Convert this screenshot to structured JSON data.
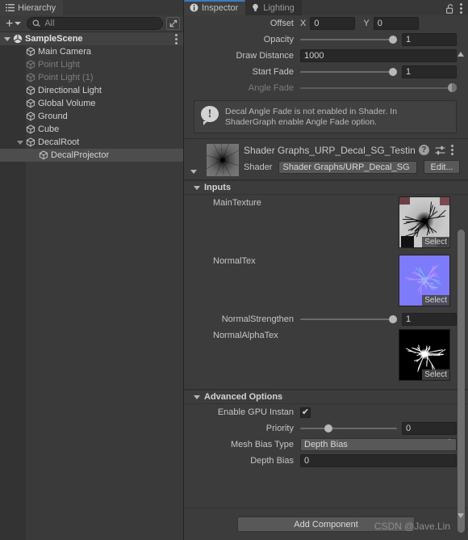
{
  "hierarchy": {
    "tab_label": "Hierarchy",
    "tab_icon": "list-icon",
    "toolbar": {
      "create_label": "+",
      "search_placeholder": "All",
      "search_icon": "search-icon",
      "dock_icon": "dock-icon"
    },
    "items": [
      {
        "label": "SampleScene",
        "indent": 0,
        "icon": "unity-scene-icon",
        "twirl": "down",
        "state": "scene",
        "kebab": true
      },
      {
        "label": "Main Camera",
        "indent": 1,
        "icon": "gameobject-icon",
        "twirl": "none",
        "state": "normal",
        "kebab": false
      },
      {
        "label": "Point Light",
        "indent": 1,
        "icon": "gameobject-icon",
        "twirl": "none",
        "state": "disabled",
        "kebab": false
      },
      {
        "label": "Point Light (1)",
        "indent": 1,
        "icon": "gameobject-icon",
        "twirl": "none",
        "state": "disabled",
        "kebab": false
      },
      {
        "label": "Directional Light",
        "indent": 1,
        "icon": "gameobject-icon",
        "twirl": "none",
        "state": "normal",
        "kebab": false
      },
      {
        "label": "Global Volume",
        "indent": 1,
        "icon": "gameobject-icon",
        "twirl": "none",
        "state": "normal",
        "kebab": false
      },
      {
        "label": "Ground",
        "indent": 1,
        "icon": "gameobject-icon",
        "twirl": "none",
        "state": "normal",
        "kebab": false
      },
      {
        "label": "Cube",
        "indent": 1,
        "icon": "gameobject-icon",
        "twirl": "none",
        "state": "normal",
        "kebab": false
      },
      {
        "label": "DecalRoot",
        "indent": 1,
        "icon": "gameobject-icon",
        "twirl": "down",
        "state": "normal",
        "kebab": false
      },
      {
        "label": "DecalProjector",
        "indent": 2,
        "icon": "gameobject-icon",
        "twirl": "none",
        "state": "selected",
        "kebab": false
      }
    ]
  },
  "inspector": {
    "tabs": [
      {
        "label": "Inspector",
        "icon": "info-icon",
        "active": true
      },
      {
        "label": "Lighting",
        "icon": "bulb-icon",
        "active": false
      }
    ],
    "lock_icon": "lock-open-icon",
    "menu_icon": "kebab-icon",
    "decal_properties": [
      {
        "name": "offset",
        "label": "Offset",
        "type": "vector2",
        "x": "0",
        "y": "0",
        "disabled": false
      },
      {
        "name": "opacity",
        "label": "Opacity",
        "type": "slider",
        "value": "1",
        "percent": 100,
        "disabled": false
      },
      {
        "name": "draw-distance",
        "label": "Draw Distance",
        "type": "number",
        "value": "1000",
        "disabled": false
      },
      {
        "name": "start-fade",
        "label": "Start Fade",
        "type": "slider",
        "value": "1",
        "percent": 100,
        "disabled": false
      },
      {
        "name": "angle-fade",
        "label": "Angle Fade",
        "type": "range",
        "percent": 100,
        "disabled": true
      }
    ],
    "warning": {
      "icon": "warning-icon",
      "text": "Decal Angle Fade is not enabled in Shader. In ShaderGraph enable Angle Fade option."
    },
    "material": {
      "title": "Shader Graphs_URP_Decal_SG_Testin",
      "preview_icon": "material-preview",
      "help_icon": "help-icon",
      "preset_icon": "preset-icon",
      "menu_icon": "kebab-icon",
      "shader_label": "Shader",
      "shader_value": "Shader Graphs/URP_Decal_SG",
      "edit_label": "Edit..."
    },
    "inputs_section": {
      "title": "Inputs",
      "expanded": true,
      "textures": [
        {
          "name": "main-texture",
          "label": "MainTexture",
          "select_label": "Select",
          "preview": "crack-dark"
        },
        {
          "name": "normal-texture",
          "label": "NormalTex",
          "select_label": "Select",
          "preview": "normal-map"
        },
        {
          "name": "normal-alpha-texture",
          "label": "NormalAlphaTex",
          "select_label": "Select",
          "preview": "crack-white"
        }
      ],
      "normal_strengthen": {
        "label": "NormalStrengthen",
        "value": "1",
        "percent": 100
      }
    },
    "advanced_section": {
      "title": "Advanced Options",
      "expanded": true,
      "gpu_instancing": {
        "label": "Enable GPU Instan",
        "checked": true,
        "check_glyph": "✔"
      },
      "priority": {
        "label": "Priority",
        "value": "0",
        "percent": 33
      },
      "mesh_bias_type": {
        "label": "Mesh Bias Type",
        "value": "Depth Bias"
      },
      "depth_bias": {
        "label": "Depth Bias",
        "value": "0"
      }
    },
    "add_component_label": "Add Component",
    "watermark": "CSDN @Jave.Lin"
  },
  "colors": {
    "panel_bg": "#3c3c3c",
    "hierarchy_bg": "#3a3a3a",
    "tab_accent": "#3e7bbd",
    "selection": "#4d4d4d",
    "field_bg": "#282828",
    "button_bg": "#585858",
    "text": "#c4c4c4",
    "text_dim": "#7e7e7e",
    "normal_map": "#7e7bfb"
  }
}
